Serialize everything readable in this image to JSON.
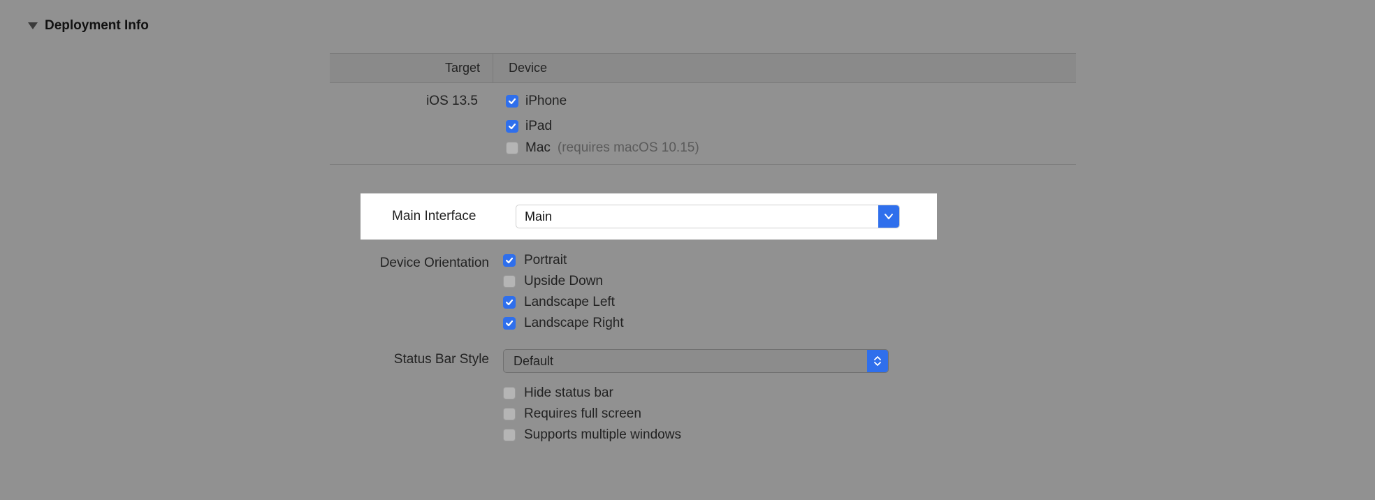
{
  "section": {
    "title": "Deployment Info"
  },
  "table": {
    "headers": {
      "target": "Target",
      "device": "Device"
    },
    "target_version": "iOS 13.5",
    "devices": {
      "iphone": {
        "label": "iPhone",
        "checked": true
      },
      "ipad": {
        "label": "iPad",
        "checked": true
      },
      "mac": {
        "label": "Mac",
        "checked": false,
        "note": "(requires macOS 10.15)"
      }
    }
  },
  "main_interface": {
    "label": "Main Interface",
    "value": "Main"
  },
  "orientation": {
    "label": "Device Orientation",
    "options": {
      "portrait": {
        "label": "Portrait",
        "checked": true
      },
      "upside_down": {
        "label": "Upside Down",
        "checked": false
      },
      "landscape_left": {
        "label": "Landscape Left",
        "checked": true
      },
      "landscape_right": {
        "label": "Landscape Right",
        "checked": true
      }
    }
  },
  "status_bar": {
    "label": "Status Bar Style",
    "value": "Default",
    "options": {
      "hide": {
        "label": "Hide status bar",
        "checked": false
      },
      "full": {
        "label": "Requires full screen",
        "checked": false
      },
      "multiwin": {
        "label": "Supports multiple windows",
        "checked": false
      }
    }
  }
}
